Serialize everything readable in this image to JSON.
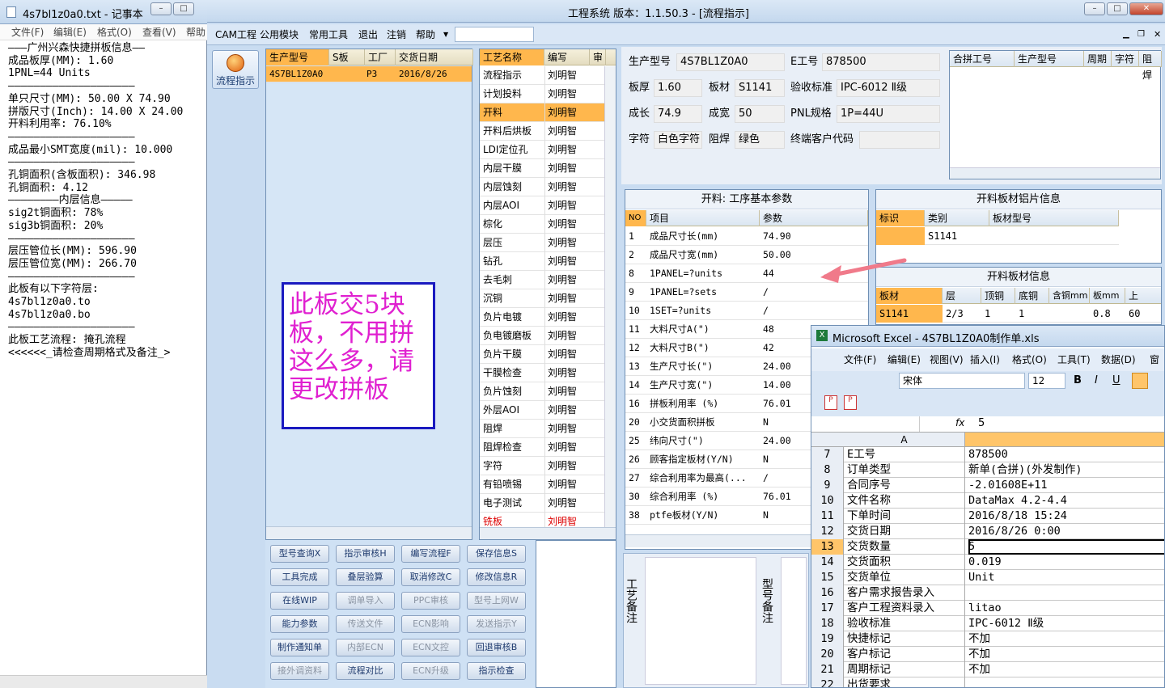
{
  "notepad": {
    "title": "4s7bl1z0a0.txt - 记事本",
    "menu": [
      "文件(F)",
      "编辑(E)",
      "格式(O)",
      "查看(V)",
      "帮助"
    ],
    "lines": [
      "———广州兴森快捷拼板信息——",
      "成品板厚(MM): 1.60",
      "1PNL=44 Units",
      "————————————————————",
      "单只尺寸(MM): 50.00 X 74.90",
      "拼版尺寸(Inch): 14.00 X 24.00",
      "开料利用率: 76.10%",
      "————————————————————",
      "成品最小SMT宽度(mil): 10.000",
      "————————————————————",
      "孔铜面积(含板面积): 346.98",
      "孔铜面积: 4.12",
      "————————内层信息—————",
      "sig2t铜面积: 78%",
      "sig3b铜面积: 20%",
      "————————————————————",
      "层压管位长(MM): 596.90",
      "层压管位宽(MM): 266.70",
      "————————————————————",
      "此板有以下字符层:",
      "4s7bl1z0a0.to",
      "4s7bl1z0a0.bo",
      "————————————————————",
      "此板工艺流程: 掩孔流程",
      "<<<<<<_请检查周期格式及备注_>"
    ]
  },
  "main": {
    "title": "工程系统  版本：1.1.50.3 - [流程指示]",
    "menu": [
      "CAM工程",
      "公用模块",
      "常用工具",
      "退出",
      "注销",
      "帮助"
    ],
    "side_button": "流程指示",
    "order_grid": {
      "headers": [
        "生产型号",
        "S板",
        "工厂",
        "交货日期"
      ],
      "row": [
        "4S7BL1Z0A0",
        "",
        "P3",
        "2016/8/26"
      ]
    },
    "annotation": "此板交5块板，不用拼这么多，请更改拼板",
    "process_grid": {
      "headers": [
        "工艺名称",
        "编写",
        "审"
      ],
      "rows": [
        [
          "流程指示",
          "刘明智"
        ],
        [
          "计划投料",
          "刘明智"
        ],
        [
          "开料",
          "刘明智"
        ],
        [
          "开料后烘板",
          "刘明智"
        ],
        [
          "LDI定位孔",
          "刘明智"
        ],
        [
          "内层干膜",
          "刘明智"
        ],
        [
          "内层蚀刻",
          "刘明智"
        ],
        [
          "内层AOI",
          "刘明智"
        ],
        [
          "棕化",
          "刘明智"
        ],
        [
          "层压",
          "刘明智"
        ],
        [
          "钻孔",
          "刘明智"
        ],
        [
          "去毛刺",
          "刘明智"
        ],
        [
          "沉铜",
          "刘明智"
        ],
        [
          "负片电镀",
          "刘明智"
        ],
        [
          "负电镀磨板",
          "刘明智"
        ],
        [
          "负片干膜",
          "刘明智"
        ],
        [
          "干膜检查",
          "刘明智"
        ],
        [
          "负片蚀刻",
          "刘明智"
        ],
        [
          "外层AOI",
          "刘明智"
        ],
        [
          "阻焊",
          "刘明智"
        ],
        [
          "阻焊检查",
          "刘明智"
        ],
        [
          "字符",
          "刘明智"
        ],
        [
          "有铅喷锡",
          "刘明智"
        ],
        [
          "电子测试",
          "刘明智"
        ],
        [
          "铣板",
          "刘明智"
        ]
      ]
    },
    "buttons": [
      [
        "型号查询X",
        "指示审核H",
        "编写流程F",
        "保存信息S"
      ],
      [
        "工具完成",
        "叠层验算",
        "取消修改C",
        "修改信息R"
      ],
      [
        "在线WIP",
        "调单导入",
        "PPC审核",
        "型号上网W"
      ],
      [
        "能力参数",
        "传送文件",
        "ECN影响",
        "发送指示Y"
      ],
      [
        "制作通知单",
        "内部ECN",
        "ECN文控",
        "回退审核B"
      ],
      [
        "接外调资料",
        "流程对比",
        "ECN升级",
        "指示检查"
      ]
    ],
    "buttons_disabled": [
      [
        false,
        false,
        false,
        false
      ],
      [
        false,
        false,
        false,
        false
      ],
      [
        false,
        true,
        true,
        true
      ],
      [
        false,
        true,
        true,
        true
      ],
      [
        false,
        true,
        true,
        false
      ],
      [
        true,
        false,
        true,
        false
      ]
    ],
    "info": {
      "model_lbl": "生产型号",
      "model": "4S7BL1Z0A0",
      "eno_lbl": "E工号",
      "eno": "878500",
      "thick_lbl": "板厚",
      "thick": "1.60",
      "mat_lbl": "板材",
      "mat": "S1141",
      "std_lbl": "验收标准",
      "std": "IPC-6012 Ⅱ级",
      "len_lbl": "成长",
      "len": "74.9",
      "wid_lbl": "成宽",
      "wid": "50",
      "pnl_lbl": "PNL规格",
      "pnl": "1P=44U",
      "char_lbl": "字符",
      "char": "白色字符",
      "mask_lbl": "阻焊",
      "mask": "绿色",
      "cust_lbl": "终端客户代码",
      "cust": ""
    },
    "combine_headers": [
      "合拼工号",
      "生产型号",
      "周期",
      "字符",
      "阻焊"
    ],
    "param": {
      "title": "开料: 工序基本参数",
      "headers": [
        "NO",
        "项目",
        "参数"
      ],
      "rows": [
        [
          "1",
          "成品尺寸长(mm)",
          "74.90"
        ],
        [
          "2",
          "成品尺寸宽(mm)",
          "50.00"
        ],
        [
          "8",
          "1PANEL=?units",
          "44"
        ],
        [
          "9",
          "1PANEL=?sets",
          "/"
        ],
        [
          "10",
          "1SET=?units",
          "/"
        ],
        [
          "11",
          "大料尺寸A(\")",
          "48"
        ],
        [
          "12",
          "大料尺寸B(\")",
          "42"
        ],
        [
          "13",
          "生产尺寸长(\")",
          "24.00"
        ],
        [
          "14",
          "生产尺寸宽(\")",
          "14.00"
        ],
        [
          "16",
          "拼板利用率 (%)",
          "76.01"
        ],
        [
          "20",
          "小交货面积拼板",
          "N"
        ],
        [
          "25",
          "纬向尺寸(\")",
          "24.00"
        ],
        [
          "26",
          "顾客指定板材(Y/N)",
          "N"
        ],
        [
          "27",
          "综合利用率为最高(...",
          "/"
        ],
        [
          "30",
          "综合利用率 (%)",
          "76.01"
        ],
        [
          "38",
          "ptfe板材(Y/N)",
          "N"
        ]
      ]
    },
    "mat_alu": {
      "title": "开料板材铝片信息",
      "headers": [
        "标识",
        "类别",
        "板材型号"
      ],
      "row": [
        "",
        "S1141",
        ""
      ]
    },
    "mat_info": {
      "title": "开料板材信息",
      "headers": [
        "板材",
        "层",
        "顶铜",
        "底铜",
        "含铜mm",
        "板mm",
        "上"
      ],
      "row": [
        "S1141",
        "2/3",
        "1",
        "1",
        "",
        "0.8",
        "60"
      ]
    },
    "notes": {
      "proc": "工艺备注",
      "model": "型号备注"
    }
  },
  "excel": {
    "title": "Microsoft Excel - 4S7BL1Z0A0制作单.xls",
    "menu": [
      "文件(F)",
      "编辑(E)",
      "视图(V)",
      "插入(I)",
      "格式(O)",
      "工具(T)",
      "数据(D)",
      "窗"
    ],
    "font": "宋体",
    "size": "12",
    "fx_value": "5",
    "col": "A",
    "rows": [
      [
        "7",
        "E工号",
        "878500"
      ],
      [
        "8",
        "订单类型",
        "新单(合拼)(外发制作)"
      ],
      [
        "9",
        "合同序号",
        "-2.01608E+11"
      ],
      [
        "10",
        "文件名称",
        "DataMax 4.2-4.4"
      ],
      [
        "11",
        "下单时间",
        "2016/8/18 15:24"
      ],
      [
        "12",
        "交货日期",
        "2016/8/26 0:00"
      ],
      [
        "13",
        "交货数量",
        "5"
      ],
      [
        "14",
        "交货面积",
        "0.019"
      ],
      [
        "15",
        "交货单位",
        "Unit"
      ],
      [
        "16",
        "客户需求报告录入",
        ""
      ],
      [
        "17",
        "客户工程资料录入",
        "litao"
      ],
      [
        "18",
        "验收标准",
        "IPC-6012 Ⅱ级"
      ],
      [
        "19",
        "快捷标记",
        "不加"
      ],
      [
        "20",
        "客户标记",
        "不加"
      ],
      [
        "21",
        "周期标记",
        "不加"
      ],
      [
        "22",
        "出货要求",
        ""
      ]
    ]
  },
  "colors": {
    "highlight": "#ffb74d",
    "accent": "#e8f0fa",
    "annot": "#e020d0",
    "arrow": "#f07a8a"
  }
}
